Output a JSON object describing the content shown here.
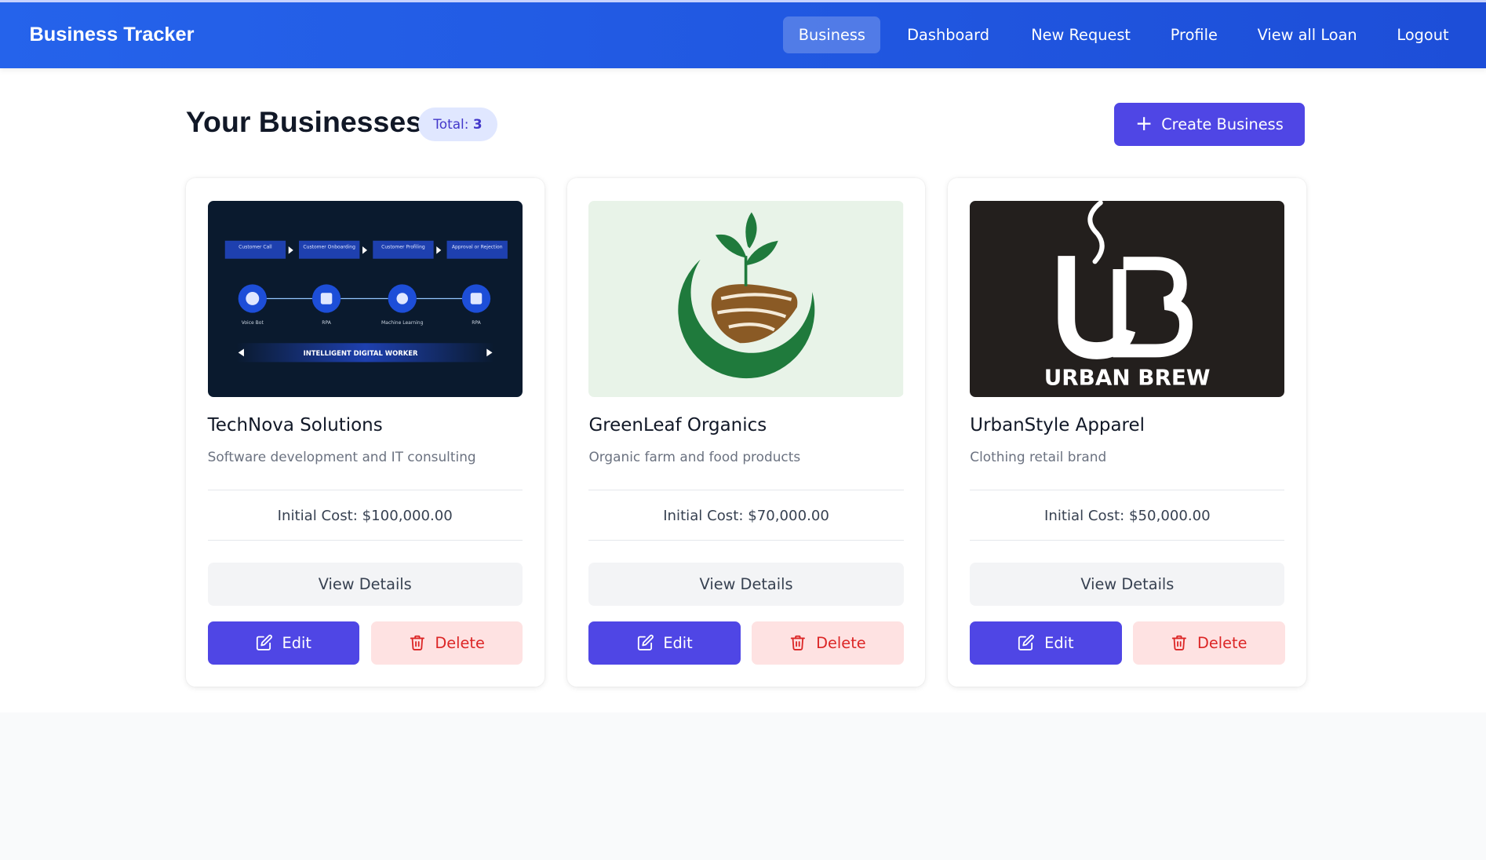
{
  "app": {
    "title": "Business Tracker"
  },
  "nav": {
    "items": [
      {
        "label": "Business"
      },
      {
        "label": "Dashboard"
      },
      {
        "label": "New Request"
      },
      {
        "label": "Profile"
      },
      {
        "label": "View all Loan"
      },
      {
        "label": "Logout"
      }
    ],
    "active": "Business"
  },
  "header": {
    "title": "Your Businesses",
    "total_label": "Total:",
    "total_count": "3",
    "create_label": "Create Business"
  },
  "businesses": [
    {
      "name": "TechNova Solutions",
      "description": "Software development and IT consulting",
      "cost": "Initial Cost: $100,000.00",
      "view_label": "View Details",
      "edit_label": "Edit",
      "delete_label": "Delete",
      "image": {
        "steps": [
          "Customer Call",
          "Customer Onboarding",
          "Customer Profiling",
          "Approval or Rejection"
        ],
        "nodes": [
          "Voice Bot",
          "RPA",
          "Machine Learning",
          "RPA"
        ],
        "banner": "INTELLIGENT DIGITAL WORKER"
      }
    },
    {
      "name": "GreenLeaf Organics",
      "description": "Organic farm and food products",
      "cost": "Initial Cost: $70,000.00",
      "view_label": "View Details",
      "edit_label": "Edit",
      "delete_label": "Delete"
    },
    {
      "name": "UrbanStyle Apparel",
      "description": "Clothing retail brand",
      "cost": "Initial Cost: $50,000.00",
      "view_label": "View Details",
      "edit_label": "Edit",
      "delete_label": "Delete",
      "image": {
        "logo_text": "URBAN BREW"
      }
    }
  ],
  "colors": {
    "navbar": "#2563eb",
    "primary": "#4f46e5",
    "danger_bg": "#fee2e2",
    "danger_text": "#dc2626",
    "pill_bg": "#e0e7ff"
  }
}
